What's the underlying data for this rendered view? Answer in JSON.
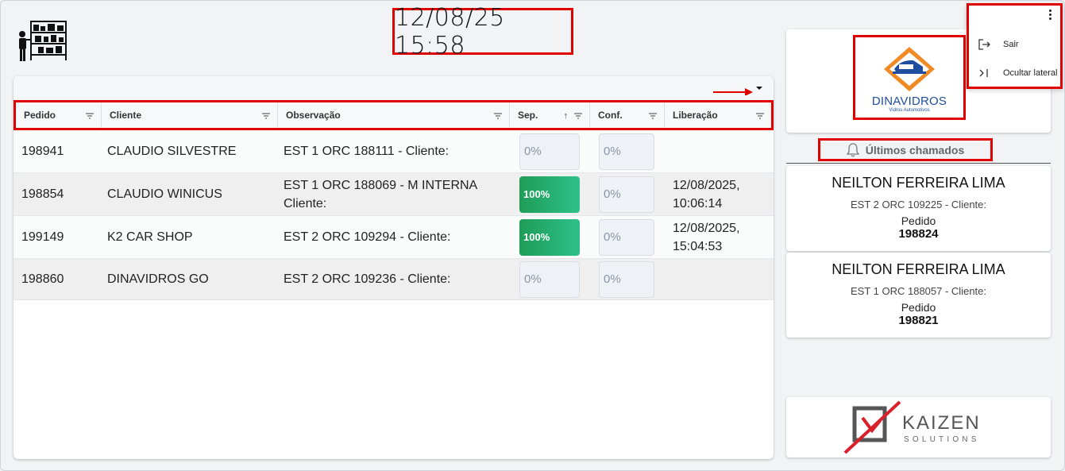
{
  "clock": "12/08/25 15:58",
  "table": {
    "columns": [
      {
        "key": "pedido",
        "label": "Pedido"
      },
      {
        "key": "cliente",
        "label": "Cliente"
      },
      {
        "key": "observacao",
        "label": "Observação"
      },
      {
        "key": "sep",
        "label": "Sep."
      },
      {
        "key": "conf",
        "label": "Conf."
      },
      {
        "key": "liberacao",
        "label": "Liberação"
      }
    ],
    "sort": {
      "column": "Sep.",
      "direction": "ascending"
    },
    "rows": [
      {
        "pedido": "198941",
        "cliente": "CLAUDIO SILVESTRE",
        "obs1": "EST 1 ORC 188111 - Cliente:",
        "obs2": "",
        "sep": "0%",
        "sep_progress": 0,
        "conf": "0%",
        "conf_progress": 0,
        "lib1": "",
        "lib2": ""
      },
      {
        "pedido": "198854",
        "cliente": "CLAUDIO WINICUS",
        "obs1": "EST 1 ORC 188069 - M INTERNA",
        "obs2": "Cliente:",
        "sep": "100%",
        "sep_progress": 100,
        "conf": "0%",
        "conf_progress": 0,
        "lib1": "12/08/2025,",
        "lib2": "10:06:14"
      },
      {
        "pedido": "199149",
        "cliente": "K2 CAR SHOP",
        "obs1": "EST 2 ORC 109294 - Cliente:",
        "obs2": "",
        "sep": "100%",
        "sep_progress": 100,
        "conf": "0%",
        "conf_progress": 0,
        "lib1": "12/08/2025,",
        "lib2": "15:04:53"
      },
      {
        "pedido": "198860",
        "cliente": "DINAVIDROS GO",
        "obs1": "EST 2 ORC 109236 - Cliente:",
        "obs2": "",
        "sep": "0%",
        "sep_progress": 0,
        "conf": "0%",
        "conf_progress": 0,
        "lib1": "",
        "lib2": ""
      }
    ]
  },
  "sidebar": {
    "logo": {
      "name": "DINAVIDROS",
      "tagline": "Vidros Automotivos"
    },
    "calls_title": "Últimos chamados",
    "calls": [
      {
        "name": "NEILTON FERREIRA LIMA",
        "obs": "EST 2 ORC 109225 - Cliente:",
        "pedido_label": "Pedido",
        "pedido": "198824"
      },
      {
        "name": "NEILTON FERREIRA LIMA",
        "obs": "EST 1 ORC 188057 - Cliente:",
        "pedido_label": "Pedido",
        "pedido": "198821"
      }
    ],
    "footer_logo": {
      "name": "KAIZEN",
      "sub": "SOLUTIONS"
    }
  },
  "menu": {
    "items": [
      {
        "label": "Sair",
        "icon": "logout-icon"
      },
      {
        "label": "Ocultar lateral",
        "icon": "collapse-sidebar-icon"
      }
    ]
  },
  "colors": {
    "highlight": "#e00000",
    "progress_full": "#26a96c",
    "brand_blue": "#1f4e9e",
    "brand_orange": "#f08a24"
  }
}
